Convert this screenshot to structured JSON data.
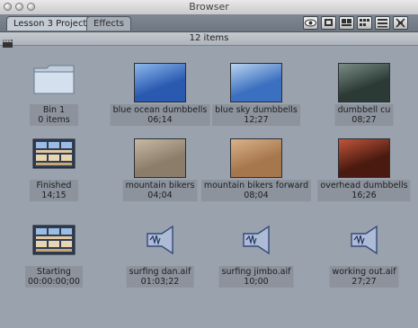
{
  "window": {
    "title": "Browser"
  },
  "tabs": [
    {
      "label": "Lesson 3 Project",
      "active": true
    },
    {
      "label": "Effects",
      "active": false
    }
  ],
  "toolbar": {
    "buttons": [
      {
        "name": "eye-icon"
      },
      {
        "name": "view-large-icon"
      },
      {
        "name": "view-medium-icon"
      },
      {
        "name": "view-small-icon"
      },
      {
        "name": "view-list-icon"
      },
      {
        "name": "view-details-icon"
      }
    ]
  },
  "info": {
    "count": "12 items"
  },
  "items": [
    {
      "type": "folder",
      "name": "Bin 1",
      "detail": "0 items"
    },
    {
      "type": "video",
      "name": "blue ocean dumbbells",
      "detail": "06;14",
      "colors": [
        "#2a59b0",
        "#8db8ec"
      ]
    },
    {
      "type": "video",
      "name": "blue sky dumbbells",
      "detail": "12;27",
      "colors": [
        "#3b6fbf",
        "#b9d4f0"
      ]
    },
    {
      "type": "video",
      "name": "dumbbell cu",
      "detail": "08;27",
      "colors": [
        "#2c3a36",
        "#7a8c84"
      ]
    },
    {
      "type": "sequence",
      "name": "Finished",
      "detail": "14;15"
    },
    {
      "type": "video",
      "name": "mountain bikers",
      "detail": "04;04",
      "colors": [
        "#8c7d6b",
        "#c7b9a3"
      ]
    },
    {
      "type": "video",
      "name": "mountain bikers forward",
      "detail": "08;04",
      "colors": [
        "#a6764c",
        "#d9b28a"
      ]
    },
    {
      "type": "video",
      "name": "overhead dumbbells",
      "detail": "16;26",
      "colors": [
        "#4a1a10",
        "#c0553a"
      ]
    },
    {
      "type": "sequence",
      "name": "Starting",
      "detail": "00:00:00;00"
    },
    {
      "type": "audio",
      "name": "surfing dan.aif",
      "detail": "01:03;22"
    },
    {
      "type": "audio",
      "name": "surfing jimbo.aif",
      "detail": "10;00"
    },
    {
      "type": "audio",
      "name": "working out.aif",
      "detail": "27;27"
    }
  ]
}
